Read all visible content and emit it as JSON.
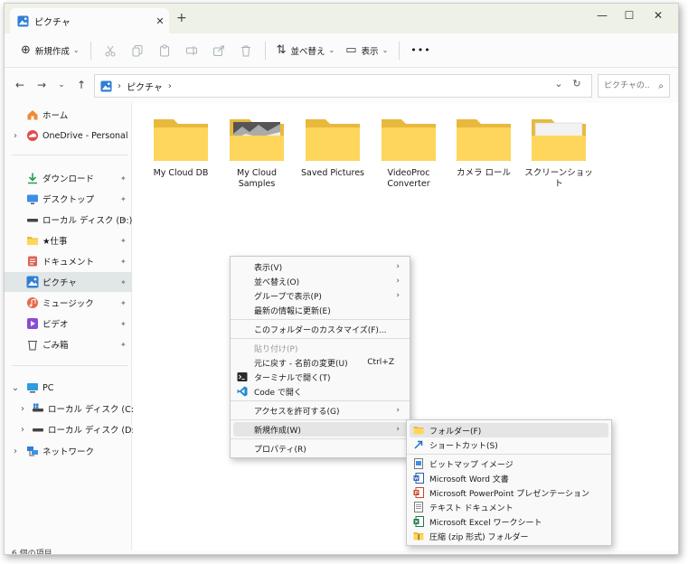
{
  "window": {
    "tab_title": "ピクチャ",
    "tab_close": "✕",
    "new_tab": "+",
    "controls": [
      "—",
      "☐",
      "✕"
    ]
  },
  "toolbar": {
    "new_label": "新規作成",
    "new_glyph": "⊕",
    "caret": "⌄",
    "sort_label": "並べ替え",
    "sort_glyph": "⇅",
    "view_label": "表示",
    "view_glyph": "▭",
    "more": "•••",
    "icons": [
      "cut-icon",
      "copy-icon",
      "paste-icon",
      "rename-icon",
      "share-icon",
      "delete-icon"
    ]
  },
  "address": {
    "back": "←",
    "forward": "→",
    "recent": "⌄",
    "up": "↑",
    "separator": "›",
    "crumb": "ピクチャ",
    "dropdown": "⌄",
    "refresh": "↻",
    "search_placeholder": "ピクチャの...",
    "search_glyph": "⌕"
  },
  "sidebar": {
    "expand": "›",
    "collapse": "⌄",
    "pin": "✦",
    "home": "ホーム",
    "onedrive": "OneDrive - Personal",
    "quick": [
      {
        "label": "ダウンロード",
        "icon": "download-icon"
      },
      {
        "label": "デスクトップ",
        "icon": "desktop-icon"
      },
      {
        "label": "ローカル ディスク (D:)",
        "icon": "drive-icon"
      },
      {
        "label": "★仕事",
        "icon": "folder-icon"
      },
      {
        "label": "ドキュメント",
        "icon": "documents-icon"
      },
      {
        "label": "ピクチャ",
        "icon": "pictures-icon"
      },
      {
        "label": "ミュージック",
        "icon": "music-icon"
      },
      {
        "label": "ビデオ",
        "icon": "video-icon"
      },
      {
        "label": "ごみ箱",
        "icon": "recycle-bin-icon"
      }
    ],
    "pc": "PC",
    "drive_c": "ローカル ディスク (C:)",
    "drive_d": "ローカル ディスク (D:)",
    "network": "ネットワーク"
  },
  "folders": [
    {
      "name": "My Cloud DB"
    },
    {
      "name": "My Cloud Samples"
    },
    {
      "name": "Saved Pictures"
    },
    {
      "name": "VideoProc Converter"
    },
    {
      "name": "カメラ ロール"
    },
    {
      "name": "スクリーンショット"
    }
  ],
  "context_menu": {
    "items": [
      {
        "label": "表示(V)",
        "arrow": "›"
      },
      {
        "label": "並べ替え(O)",
        "arrow": "›"
      },
      {
        "label": "グループで表示(P)",
        "arrow": "›"
      },
      {
        "label": "最新の情報に更新(E)"
      },
      {
        "label": "このフォルダーのカスタマイズ(F)..."
      },
      {
        "label": "貼り付け(P)"
      },
      {
        "label": "元に戻す - 名前の変更(U)",
        "accel": "Ctrl+Z"
      },
      {
        "label": "ターミナルで開く(T)"
      },
      {
        "label": "Code で開く"
      },
      {
        "label": "アクセスを許可する(G)",
        "arrow": "›"
      },
      {
        "label": "新規作成(W)",
        "arrow": "›"
      },
      {
        "label": "プロパティ(R)"
      }
    ]
  },
  "submenu": {
    "items": [
      {
        "label": "フォルダー(F)"
      },
      {
        "label": "ショートカット(S)"
      },
      {
        "label": "ビットマップ イメージ"
      },
      {
        "label": "Microsoft Word 文書"
      },
      {
        "label": "Microsoft PowerPoint プレゼンテーション"
      },
      {
        "label": "テキスト ドキュメント"
      },
      {
        "label": "Microsoft Excel ワークシート"
      },
      {
        "label": "圧縮 (zip 形式) フォルダー"
      }
    ]
  },
  "status": "6 個の項目",
  "colors": {
    "folder_back": "#e8b93c",
    "folder_front": "#ffd65c",
    "titlebar": "#eef1e6",
    "selection": "#e1e6e7"
  }
}
